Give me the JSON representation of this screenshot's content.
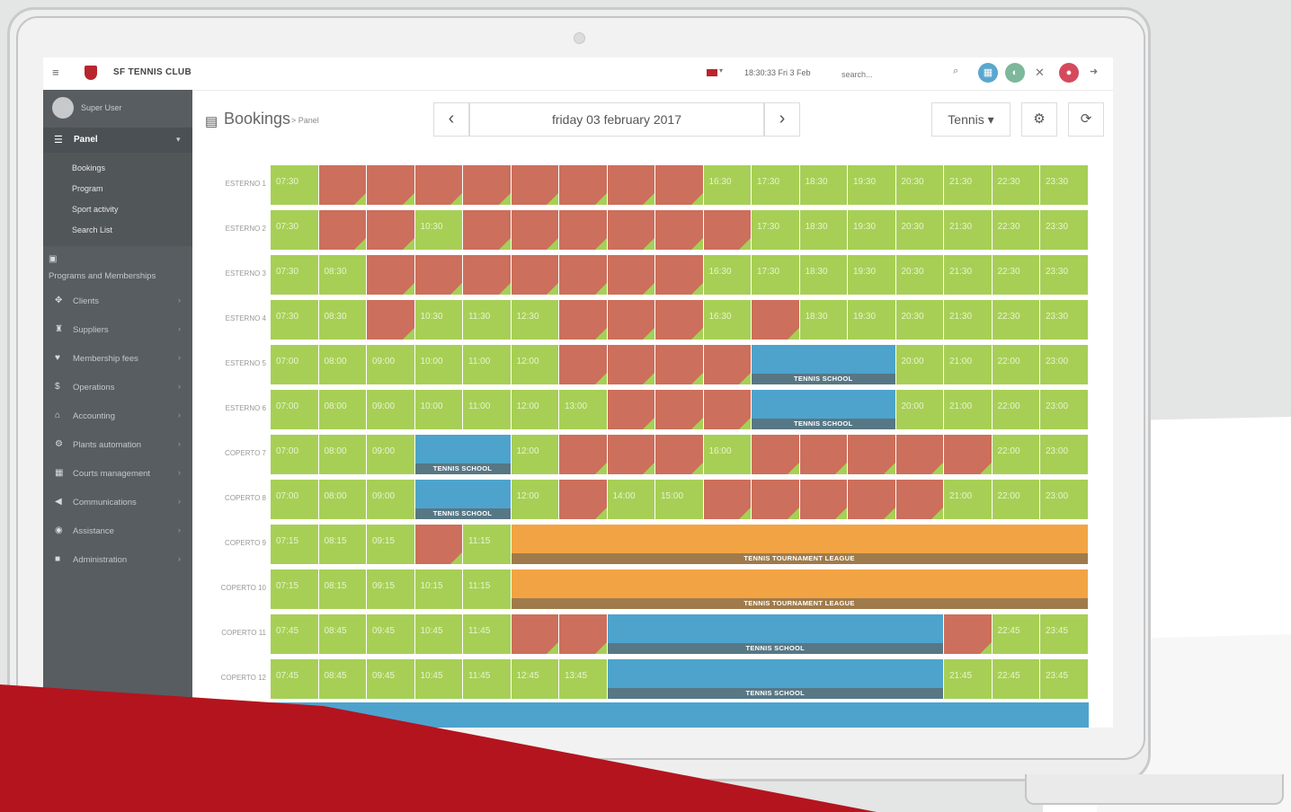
{
  "colors": {
    "free": "#a7cf56",
    "booked": "#cc6f5c",
    "school": "#4ea3cc",
    "tournament": "#f2a444",
    "brand_red": "#b8252d",
    "sidebar": "#585d61"
  },
  "topbar": {
    "brand": "SF TENNIS CLUB",
    "clock": "18:30:33 Fri 3 Feb",
    "search_placeholder": "search...",
    "menu_icon": "hamburger-icon",
    "buttons": [
      "calendar-icon",
      "user-circle-icon",
      "expand-icon",
      "notification-icon",
      "logout-icon"
    ]
  },
  "sidebar": {
    "user": "Super User",
    "panel": "Panel",
    "sub": [
      "Bookings",
      "Program",
      "Sport activity",
      "Search List"
    ],
    "items": [
      "Programs and Memberships",
      "Clients",
      "Suppliers",
      "Membership fees",
      "Operations",
      "Accounting",
      "Plants automation",
      "Courts management",
      "Communications",
      "Assistance",
      "Administration"
    ]
  },
  "header": {
    "title": "Bookings",
    "crumb": "> Panel",
    "date": "friday 03 february 2017",
    "prev": "‹",
    "next": "›",
    "sport": "Tennis ▾",
    "settings": "⚙",
    "refresh": "⟳"
  },
  "rows": [
    {
      "court": "ESTERNO 1",
      "cells": [
        [
          "f",
          "07:30"
        ],
        [
          "b"
        ],
        [
          "b"
        ],
        [
          "b"
        ],
        [
          "b"
        ],
        [
          "b"
        ],
        [
          "b"
        ],
        [
          "b"
        ],
        [
          "b"
        ],
        [
          "f",
          "16:30"
        ],
        [
          "f",
          "17:30"
        ],
        [
          "f",
          "18:30"
        ],
        [
          "f",
          "19:30"
        ],
        [
          "f",
          "20:30"
        ],
        [
          "f",
          "21:30"
        ],
        [
          "f",
          "22:30"
        ],
        [
          "f",
          "23:30"
        ]
      ]
    },
    {
      "court": "ESTERNO 2",
      "cells": [
        [
          "f",
          "07:30"
        ],
        [
          "b"
        ],
        [
          "b"
        ],
        [
          "f",
          "10:30"
        ],
        [
          "b"
        ],
        [
          "b"
        ],
        [
          "b"
        ],
        [
          "b"
        ],
        [
          "b"
        ],
        [
          "b"
        ],
        [
          "f",
          "17:30"
        ],
        [
          "f",
          "18:30"
        ],
        [
          "f",
          "19:30"
        ],
        [
          "f",
          "20:30"
        ],
        [
          "f",
          "21:30"
        ],
        [
          "f",
          "22:30"
        ],
        [
          "f",
          "23:30"
        ]
      ]
    },
    {
      "court": "ESTERNO 3",
      "cells": [
        [
          "f",
          "07:30"
        ],
        [
          "f",
          "08:30"
        ],
        [
          "b"
        ],
        [
          "b"
        ],
        [
          "b"
        ],
        [
          "b"
        ],
        [
          "b"
        ],
        [
          "b"
        ],
        [
          "b"
        ],
        [
          "f",
          "16:30"
        ],
        [
          "f",
          "17:30"
        ],
        [
          "f",
          "18:30"
        ],
        [
          "f",
          "19:30"
        ],
        [
          "f",
          "20:30"
        ],
        [
          "f",
          "21:30"
        ],
        [
          "f",
          "22:30"
        ],
        [
          "f",
          "23:30"
        ]
      ]
    },
    {
      "court": "ESTERNO 4",
      "cells": [
        [
          "f",
          "07:30"
        ],
        [
          "f",
          "08:30"
        ],
        [
          "b"
        ],
        [
          "f",
          "10:30"
        ],
        [
          "f",
          "11:30"
        ],
        [
          "f",
          "12:30"
        ],
        [
          "b"
        ],
        [
          "b"
        ],
        [
          "b"
        ],
        [
          "f",
          "16:30"
        ],
        [
          "b"
        ],
        [
          "f",
          "18:30"
        ],
        [
          "f",
          "19:30"
        ],
        [
          "f",
          "20:30"
        ],
        [
          "f",
          "21:30"
        ],
        [
          "f",
          "22:30"
        ],
        [
          "f",
          "23:30"
        ]
      ]
    },
    {
      "court": "ESTERNO 5",
      "cells": [
        [
          "f",
          "07:00"
        ],
        [
          "f",
          "08:00"
        ],
        [
          "f",
          "09:00"
        ],
        [
          "f",
          "10:00"
        ],
        [
          "f",
          "11:00"
        ],
        [
          "f",
          "12:00"
        ],
        [
          "b"
        ],
        [
          "b"
        ],
        [
          "b"
        ],
        [
          "b"
        ],
        [
          "s",
          "TENNIS SCHOOL",
          3
        ],
        [
          "f",
          "20:00"
        ],
        [
          "f",
          "21:00"
        ],
        [
          "f",
          "22:00"
        ],
        [
          "f",
          "23:00"
        ]
      ]
    },
    {
      "court": "ESTERNO 6",
      "cells": [
        [
          "f",
          "07:00"
        ],
        [
          "f",
          "08:00"
        ],
        [
          "f",
          "09:00"
        ],
        [
          "f",
          "10:00"
        ],
        [
          "f",
          "11:00"
        ],
        [
          "f",
          "12:00"
        ],
        [
          "f",
          "13:00"
        ],
        [
          "b"
        ],
        [
          "b"
        ],
        [
          "b"
        ],
        [
          "s",
          "TENNIS SCHOOL",
          3
        ],
        [
          "f",
          "20:00"
        ],
        [
          "f",
          "21:00"
        ],
        [
          "f",
          "22:00"
        ],
        [
          "f",
          "23:00"
        ]
      ]
    },
    {
      "court": "COPERTO 7",
      "cells": [
        [
          "f",
          "07:00"
        ],
        [
          "f",
          "08:00"
        ],
        [
          "f",
          "09:00"
        ],
        [
          "s",
          "TENNIS SCHOOL",
          2
        ],
        [
          "f",
          "12:00"
        ],
        [
          "b"
        ],
        [
          "b"
        ],
        [
          "b"
        ],
        [
          "f",
          "16:00"
        ],
        [
          "b"
        ],
        [
          "b"
        ],
        [
          "b"
        ],
        [
          "b"
        ],
        [
          "b"
        ],
        [
          "f",
          "22:00"
        ],
        [
          "f",
          "23:00"
        ]
      ]
    },
    {
      "court": "COPERTO 8",
      "cells": [
        [
          "f",
          "07:00"
        ],
        [
          "f",
          "08:00"
        ],
        [
          "f",
          "09:00"
        ],
        [
          "s",
          "TENNIS SCHOOL",
          2
        ],
        [
          "f",
          "12:00"
        ],
        [
          "b"
        ],
        [
          "f",
          "14:00"
        ],
        [
          "f",
          "15:00"
        ],
        [
          "b"
        ],
        [
          "b"
        ],
        [
          "b"
        ],
        [
          "b"
        ],
        [
          "b"
        ],
        [
          "f",
          "21:00"
        ],
        [
          "f",
          "22:00"
        ],
        [
          "f",
          "23:00"
        ]
      ]
    },
    {
      "court": "COPERTO 9",
      "cells": [
        [
          "f",
          "07:15"
        ],
        [
          "f",
          "08:15"
        ],
        [
          "f",
          "09:15"
        ],
        [
          "b"
        ],
        [
          "f",
          "11:15"
        ],
        [
          "t",
          "TENNIS TOURNAMENT LEAGUE",
          12
        ]
      ]
    },
    {
      "court": "COPERTO 10",
      "cells": [
        [
          "f",
          "07:15"
        ],
        [
          "f",
          "08:15"
        ],
        [
          "f",
          "09:15"
        ],
        [
          "f",
          "10:15"
        ],
        [
          "f",
          "11:15"
        ],
        [
          "t",
          "TENNIS TOURNAMENT LEAGUE",
          12
        ]
      ]
    },
    {
      "court": "COPERTO 11",
      "cells": [
        [
          "f",
          "07:45"
        ],
        [
          "f",
          "08:45"
        ],
        [
          "f",
          "09:45"
        ],
        [
          "f",
          "10:45"
        ],
        [
          "f",
          "11:45"
        ],
        [
          "b"
        ],
        [
          "b"
        ],
        [
          "s",
          "TENNIS SCHOOL",
          7
        ],
        [
          "b"
        ],
        [
          "f",
          "22:45"
        ],
        [
          "f",
          "23:45"
        ]
      ]
    },
    {
      "court": "COPERTO 12",
      "cells": [
        [
          "f",
          "07:45"
        ],
        [
          "f",
          "08:45"
        ],
        [
          "f",
          "09:45"
        ],
        [
          "f",
          "10:45"
        ],
        [
          "f",
          "11:45"
        ],
        [
          "f",
          "12:45"
        ],
        [
          "f",
          "13:45"
        ],
        [
          "s",
          "TENNIS SCHOOL",
          7
        ],
        [
          "f",
          "21:45"
        ],
        [
          "f",
          "22:45"
        ],
        [
          "f",
          "23:45"
        ]
      ]
    }
  ]
}
